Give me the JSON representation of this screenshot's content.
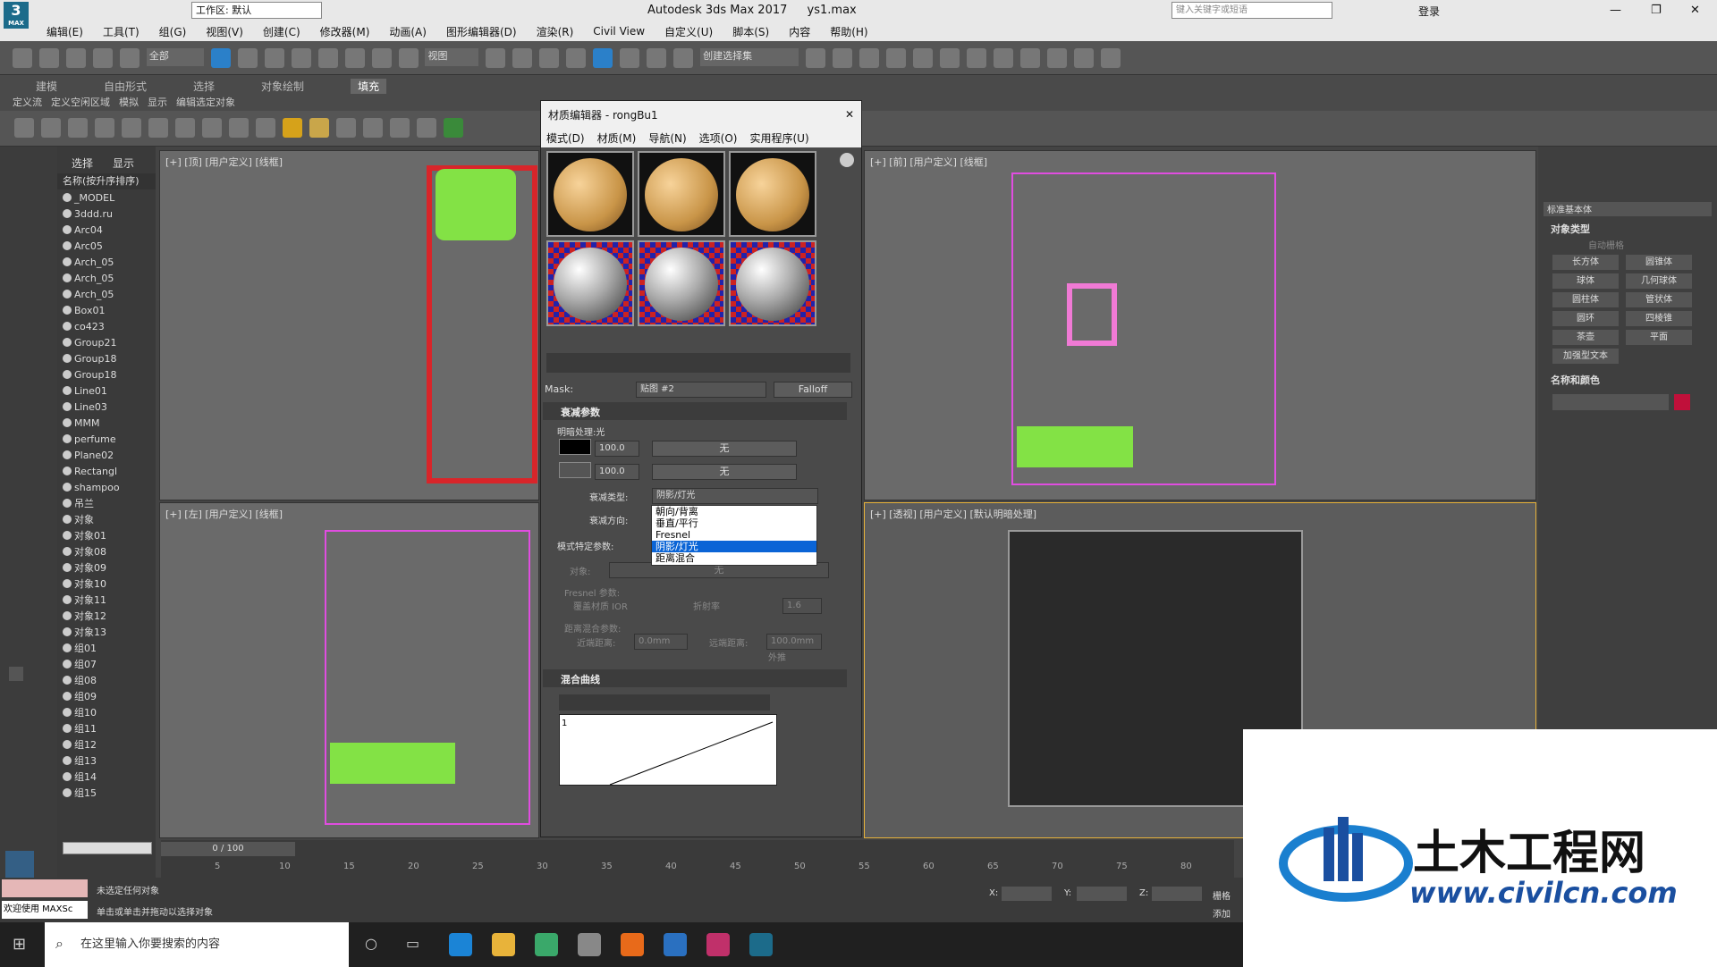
{
  "app": {
    "icon_label": "3",
    "icon_sub": "MAX",
    "workspace": "工作区: 默认",
    "title": "Autodesk 3ds Max 2017",
    "file": "ys1.max",
    "search_placeholder": "键入关键字或短语",
    "login": "登录"
  },
  "menu": [
    "编辑(E)",
    "工具(T)",
    "组(G)",
    "视图(V)",
    "创建(C)",
    "修改器(M)",
    "动画(A)",
    "图形编辑器(D)",
    "渲染(R)",
    "Civil View",
    "自定义(U)",
    "脚本(S)",
    "内容",
    "帮助(H)"
  ],
  "toolbar": {
    "filter": "全部",
    "view": "视图",
    "named_sel": "创建选择集"
  },
  "ribbon": {
    "tabs": [
      "建模",
      "自由形式",
      "选择",
      "对象绘制",
      "填充"
    ],
    "sub": [
      "定义流",
      "定义空闲区域",
      "模拟",
      "显示",
      "编辑选定对象"
    ]
  },
  "explorer": {
    "tabs": [
      "选择",
      "显示"
    ],
    "header": "名称(按升序排序)",
    "items": [
      "_MODEL",
      "3ddd.ru",
      "Arc04",
      "Arc05",
      "Arch_05",
      "Arch_05",
      "Arch_05",
      "Box01",
      "co423",
      "Group21",
      "Group18",
      "Group18",
      "Line01",
      "Line03",
      "MMM",
      "perfume",
      "Plane02",
      "Rectangl",
      "shampoo",
      "吊兰",
      "对象",
      "对象01",
      "对象08",
      "对象09",
      "对象10",
      "对象11",
      "对象12",
      "对象13",
      "组01",
      "组07",
      "组08",
      "组09",
      "组10",
      "组11",
      "组12",
      "组13",
      "组14",
      "组15"
    ]
  },
  "viewports": {
    "top": "[+] [顶] [用户定义] [线框]",
    "front": "[+] [前] [用户定义] [线框]",
    "left": "[+] [左] [用户定义] [线框]",
    "persp": "[+] [透视] [用户定义] [默认明暗处理]"
  },
  "mated": {
    "title": "材质编辑器 - rongBu1",
    "menu": [
      "模式(D)",
      "材质(M)",
      "导航(N)",
      "选项(O)",
      "实用程序(U)"
    ],
    "mask_label": "Mask:",
    "mask_value": "贴图 #2",
    "falloff": "Falloff",
    "sec1": "衰减参数",
    "front_side": "明暗处理:光",
    "v1": "100.0",
    "v2": "100.0",
    "none1": "无",
    "none2": "无",
    "type_label": "衰减类型:",
    "type_value": "阴影/灯光",
    "dir_label": "衰减方向:",
    "dropdown": [
      "朝向/背离",
      "垂直/平行",
      "Fresnel",
      "阴影/灯光",
      "距离混合"
    ],
    "mode_label": "模式特定参数:",
    "obj_label": "对象:",
    "obj_value": "无",
    "fresnel_label": "Fresnel 参数:",
    "override": "覆盖材质 IOR",
    "ior_label": "折射率",
    "ior": "1.6",
    "dist_label": "距离混合参数:",
    "near_label": "近端距离:",
    "near": "0.0mm",
    "far_label": "远端距离:",
    "far": "100.0mm",
    "extrap": "外推",
    "sec2": "混合曲线",
    "curve_tick": "1"
  },
  "cmdpanel": {
    "category": "标准基本体",
    "sec_obj": "对象类型",
    "autogrid": "自动栅格",
    "buttons": [
      "长方体",
      "圆锥体",
      "球体",
      "几何球体",
      "圆柱体",
      "管状体",
      "圆环",
      "四棱锥",
      "茶壶",
      "平面",
      "加强型文本"
    ],
    "sec_name": "名称和颜色",
    "color": "#c0103a"
  },
  "timeline": {
    "frame": "0 / 100",
    "ticks": [
      "5",
      "10",
      "15",
      "20",
      "25",
      "30",
      "35",
      "40",
      "45",
      "50",
      "55",
      "60",
      "65",
      "70",
      "75",
      "80"
    ]
  },
  "status": {
    "welcome": "欢迎使用 MAXSc",
    "line1": "未选定任何对象",
    "line2": "单击或单击并拖动以选择对象",
    "x": "X:",
    "y": "Y:",
    "z": "Z:",
    "grid": "栅格",
    "add": "添加"
  },
  "taskbar": {
    "search": "在这里输入你要搜索的内容"
  },
  "logo": {
    "cn": "土木工程网",
    "url": "www.civilcn.com"
  }
}
